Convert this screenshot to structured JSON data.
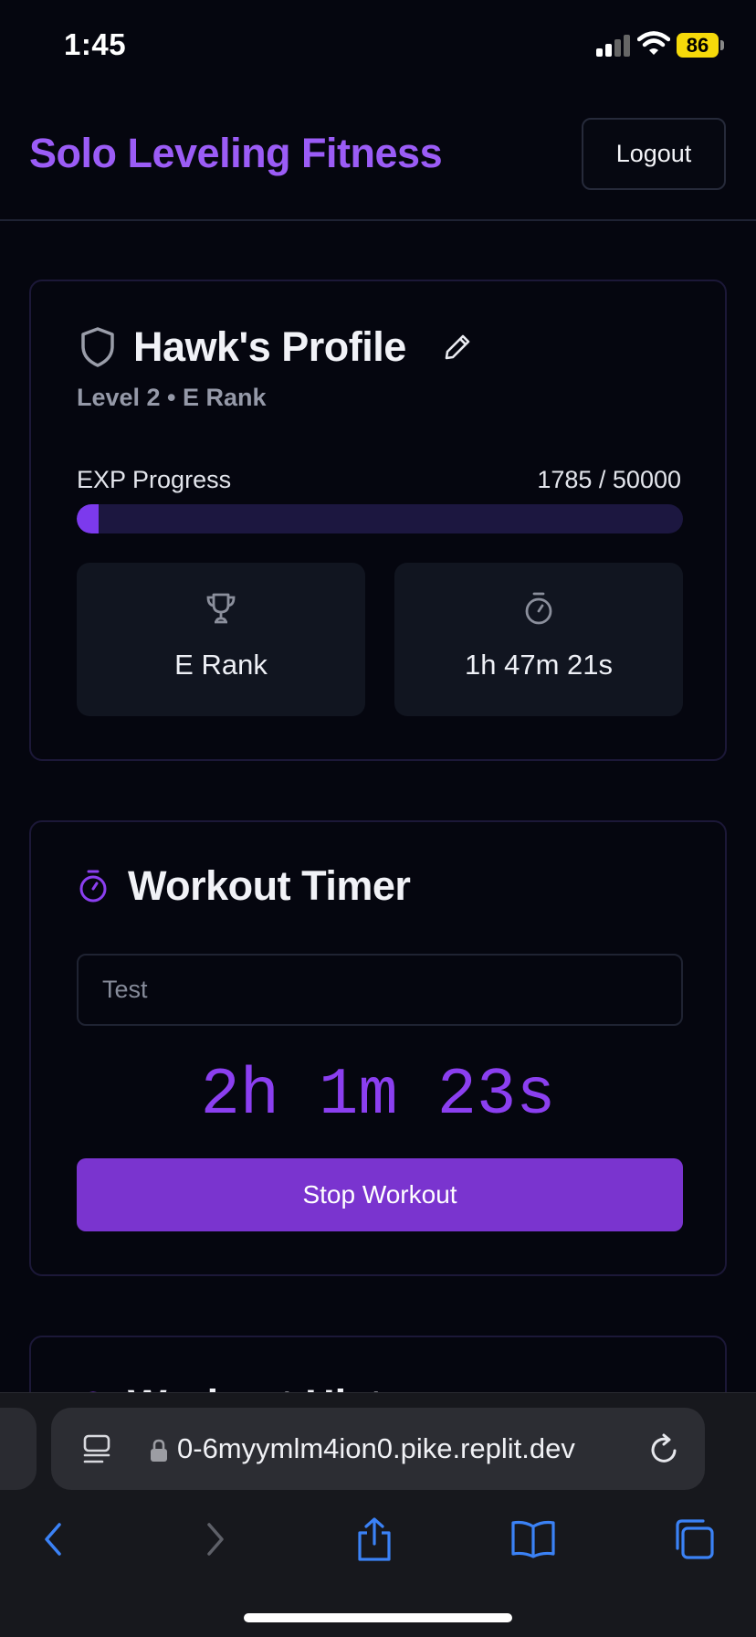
{
  "status_bar": {
    "time": "1:45",
    "battery": "86",
    "battery_color": "#f5d90a"
  },
  "header": {
    "title": "Solo Leveling Fitness",
    "logout_label": "Logout",
    "accent_color": "#9b5cf6"
  },
  "profile": {
    "icon": "shield-icon",
    "name": "Hawk's Profile",
    "edit_icon": "pencil-icon",
    "level_rank": "Level 2 • E Rank",
    "exp_label": "EXP Progress",
    "exp_text": "1785 / 50000",
    "exp_current": 1785,
    "exp_max": 50000,
    "rank_icon": "trophy-icon",
    "rank": "E Rank",
    "time_icon": "stopwatch-icon",
    "total_time": "1h 47m 21s"
  },
  "workout_timer": {
    "icon": "stopwatch-icon",
    "title": "Workout Timer",
    "input_value": "Test",
    "elapsed": "2h 1m 23s",
    "stop_label": "Stop Workout",
    "button_color": "#7a34cf"
  },
  "workout_history": {
    "icon": "history-icon",
    "title": "Workout History"
  },
  "browser": {
    "url": "0-6myymlm4ion0.pike.replit.dev",
    "reader_icon": "reader-icon",
    "lock_icon": "lock-icon",
    "reload_icon": "reload-icon",
    "nav": [
      "back-icon",
      "forward-icon",
      "share-icon",
      "bookmarks-icon",
      "tabs-icon"
    ]
  }
}
